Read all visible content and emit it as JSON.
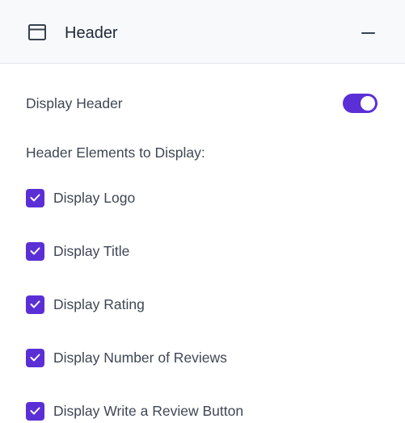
{
  "header": {
    "title": "Header",
    "icon": "browser-window-icon",
    "collapse_icon": "minus-icon"
  },
  "display_header": {
    "label": "Display Header",
    "enabled": true
  },
  "elements_section": {
    "label": "Header Elements to Display:"
  },
  "options": [
    {
      "label": "Display Logo",
      "checked": true
    },
    {
      "label": "Display Title",
      "checked": true
    },
    {
      "label": "Display Rating",
      "checked": true
    },
    {
      "label": "Display Number of Reviews",
      "checked": true
    },
    {
      "label": "Display Write a Review Button",
      "checked": true
    }
  ],
  "colors": {
    "accent": "#5b2fd6",
    "header_bg": "#f8f9fb",
    "text": "#3f4654"
  }
}
